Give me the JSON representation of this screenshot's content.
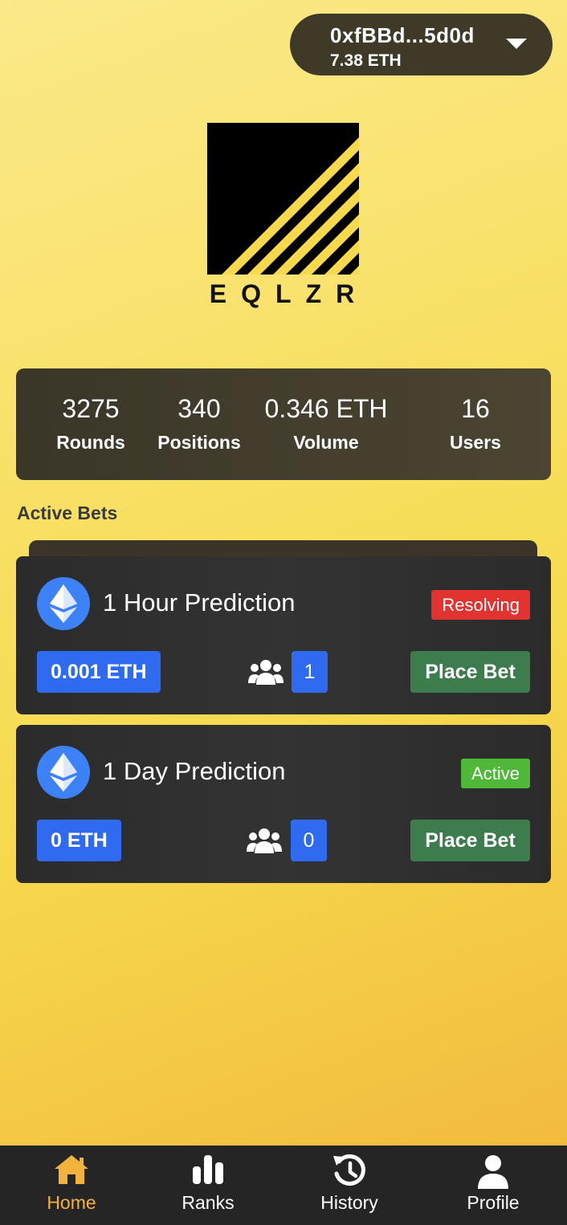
{
  "wallet": {
    "address": "0xfBBd...5d0d",
    "balance": "7.38 ETH",
    "dropdown_icon": "caret-down-icon"
  },
  "brand": {
    "name": "EQLZR",
    "logo": "striped-square-logo"
  },
  "stats": [
    {
      "value": "3275",
      "label": "Rounds"
    },
    {
      "value": "340",
      "label": "Positions"
    },
    {
      "value": "0.346 ETH",
      "label": "Volume"
    },
    {
      "value": "16",
      "label": "Users"
    }
  ],
  "active_bets": {
    "title": "Active Bets",
    "bets": [
      {
        "title": "1 Hour Prediction",
        "status": "Resolving",
        "amount": "0.001 ETH",
        "participants": "1",
        "action": "Place Bet",
        "icon": "ethereum-icon"
      },
      {
        "title": "1 Day Prediction",
        "status": "Active",
        "amount": "0 ETH",
        "participants": "0",
        "action": "Place Bet",
        "icon": "ethereum-icon"
      }
    ]
  },
  "tabs": [
    {
      "label": "Home",
      "icon": "home-icon",
      "active": true
    },
    {
      "label": "Ranks",
      "icon": "bar-chart-icon",
      "active": false
    },
    {
      "label": "History",
      "icon": "history-icon",
      "active": false
    },
    {
      "label": "Profile",
      "icon": "user-icon",
      "active": false
    }
  ],
  "colors": {
    "accent": "#f2b33c",
    "blue": "#2f6bf0",
    "green": "#3d7d4d",
    "red": "#e23330",
    "active_green": "#4fb838"
  }
}
